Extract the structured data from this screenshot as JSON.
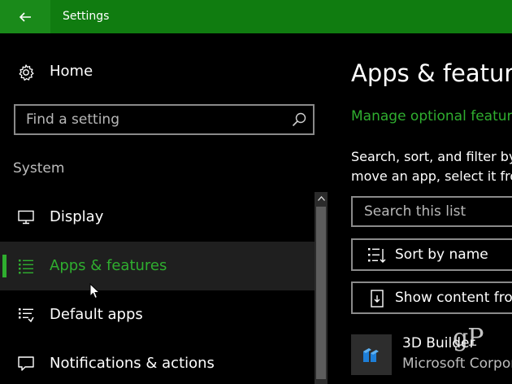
{
  "window": {
    "title": "Settings"
  },
  "colors": {
    "accent": "#107c10",
    "link": "#2fae2f",
    "background": "#000000",
    "selected_bg": "#1f1f1f"
  },
  "sidebar": {
    "home_label": "Home",
    "search_placeholder": "Find a setting",
    "group_label": "System",
    "items": [
      {
        "label": "Display",
        "icon": "monitor-icon"
      },
      {
        "label": "Apps & features",
        "icon": "list-icon",
        "selected": true
      },
      {
        "label": "Default apps",
        "icon": "default-list-icon"
      },
      {
        "label": "Notifications & actions",
        "icon": "message-icon"
      }
    ]
  },
  "main": {
    "title": "Apps & features",
    "link": "Manage optional features",
    "description_line1": "Search, sort, and filter by drive.",
    "description_line2": "move an app, select it from the list.",
    "list_search_placeholder": "Search this list",
    "sort_label": "Sort by name",
    "show_label": "Show content from all drives",
    "apps": [
      {
        "name": "3D Builder",
        "publisher": "Microsoft Corporation"
      }
    ]
  },
  "watermark": "gP"
}
